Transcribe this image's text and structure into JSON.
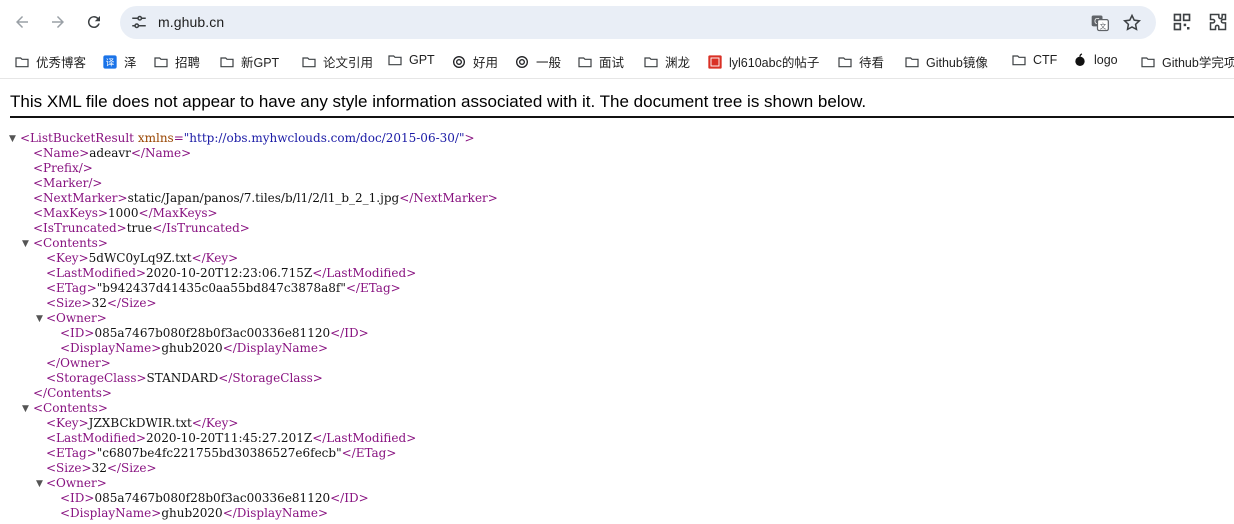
{
  "browser": {
    "url": "m.ghub.cn",
    "icons": [
      "back-icon",
      "forward-icon",
      "reload-icon",
      "site-settings-icon",
      "translate-icon",
      "star-icon",
      "qr-icon",
      "extensions-icon"
    ]
  },
  "bookmarks": [
    {
      "label": "优秀博客",
      "icon": "folder-icon"
    },
    {
      "label": "泽",
      "icon": "translate-app-icon"
    },
    {
      "label": "招聘",
      "icon": "folder-icon"
    },
    {
      "label": "新GPT",
      "icon": "folder-icon"
    },
    {
      "label": "论文引用",
      "icon": "folder-icon"
    },
    {
      "label": "GPT",
      "icon": "folder-icon"
    },
    {
      "label": "好用",
      "icon": "openai-icon"
    },
    {
      "label": "一般",
      "icon": "openai-icon"
    },
    {
      "label": "面试",
      "icon": "folder-icon"
    },
    {
      "label": "渊龙",
      "icon": "folder-icon"
    },
    {
      "label": "lyl610abc的帖子",
      "icon": "red-seal-icon"
    },
    {
      "label": "待看",
      "icon": "folder-icon"
    },
    {
      "label": "Github镜像",
      "icon": "folder-icon"
    },
    {
      "label": "CTF",
      "icon": "folder-icon"
    },
    {
      "label": "logo",
      "icon": "apple-icon"
    },
    {
      "label": "Github学完项",
      "icon": "folder-icon"
    }
  ],
  "notice": "This XML file does not appear to have any style information associated with it. The document tree is shown below.",
  "xml": {
    "root_open": "<ListBucketResult",
    "root_attr": "xmlns",
    "root_attr_val": "\"http://obs.myhwclouds.com/doc/2015-06-30/\"",
    "root_open_end": ">",
    "name_open": "<Name>",
    "name_val": "adeavr",
    "name_close": "</Name>",
    "prefix": "<Prefix/>",
    "marker": "<Marker/>",
    "nextmarker_open": "<NextMarker>",
    "nextmarker_val": "static/Japan/panos/7.tiles/b/l1/2/l1_b_2_1.jpg",
    "nextmarker_close": "</NextMarker>",
    "maxkeys_open": "<MaxKeys>",
    "maxkeys_val": "1000",
    "maxkeys_close": "</MaxKeys>",
    "trunc_open": "<IsTruncated>",
    "trunc_val": "true",
    "trunc_close": "</IsTruncated>",
    "contents_open": "<Contents>",
    "contents_close": "</Contents>",
    "key_open": "<Key>",
    "key_close": "</Key>",
    "lm_open": "<LastModified>",
    "lm_close": "</LastModified>",
    "etag_open": "<ETag>",
    "etag_close": "</ETag>",
    "size_open": "<Size>",
    "size_close": "</Size>",
    "owner_open": "<Owner>",
    "owner_close": "</Owner>",
    "id_open": "<ID>",
    "id_close": "</ID>",
    "dn_open": "<DisplayName>",
    "dn_close": "</DisplayName>",
    "sc_open": "<StorageClass>",
    "sc_close": "</StorageClass>",
    "toggle": "▼",
    "contents": [
      {
        "key": "5dWC0yLq9Z.txt",
        "last_modified": "2020-10-20T12:23:06.715Z",
        "etag": "\"b942437d41435c0aa55bd847c3878a8f\"",
        "size": "32",
        "owner_id": "085a7467b080f28b0f3ac00336e81120",
        "display_name": "ghub2020",
        "storage_class": "STANDARD"
      },
      {
        "key": "JZXBCkDWIR.txt",
        "last_modified": "2020-10-20T11:45:27.201Z",
        "etag": "\"c6807be4fc221755bd30386527e6fecb\"",
        "size": "32",
        "owner_id": "085a7467b080f28b0f3ac00336e81120",
        "display_name": "ghub2020"
      }
    ]
  }
}
